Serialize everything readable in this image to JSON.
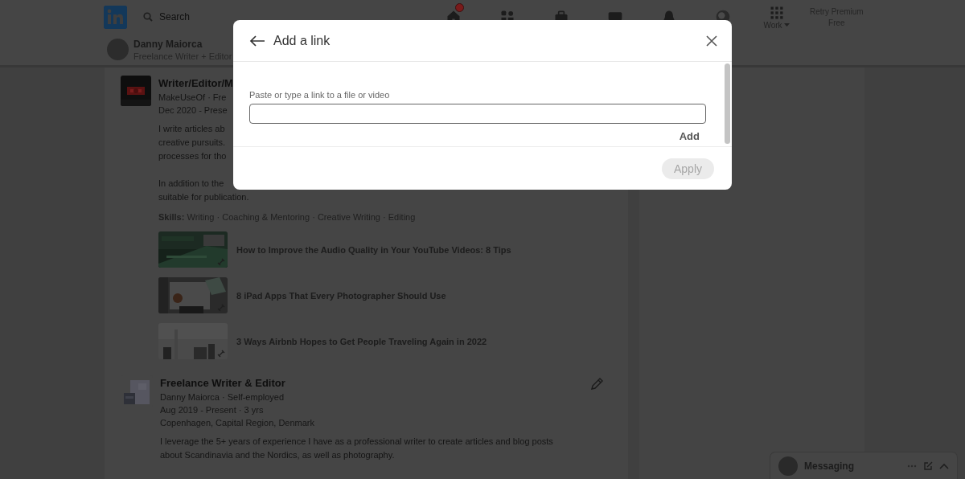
{
  "nav": {
    "search": {
      "placeholder": "Search"
    },
    "items": [
      {
        "kind": "home",
        "badge": true
      },
      {
        "kind": "network",
        "badge": false
      },
      {
        "kind": "jobs",
        "badge": false
      },
      {
        "kind": "messages",
        "badge": false
      },
      {
        "kind": "notifications",
        "badge": false
      },
      {
        "kind": "me",
        "badge": false
      },
      {
        "kind": "apps",
        "label": "Work",
        "badge": false,
        "dropdown": true
      }
    ],
    "premium": [
      "Retry Premium",
      "Free"
    ]
  },
  "profile_bar": {
    "name": "Danny Maiorca",
    "headline": "Freelance Writer + Editor"
  },
  "experience": [
    {
      "title": "Writer/Editor/M",
      "company": "MakeUseOf · Fre",
      "dates": "Dec 2020 - Prese",
      "description": [
        [
          "I write articles ab",
          "creative pursuits.",
          "processes for tho"
        ],
        [
          "In addition to the",
          "suitable for publication."
        ]
      ],
      "skills": "**Skills:** Writing · Coaching & Mentoring · Creative Writing · Editing",
      "media": [
        "How to Improve the Audio Quality in Your YouTube Videos: 8 Tips",
        "8 iPad Apps That Every Photographer Should Use",
        "3 Ways Airbnb Hopes to Get People Traveling Again in 2022"
      ]
    },
    {
      "title": "Freelance Writer & Editor",
      "company": "Danny Maiorca · Self-employed",
      "dates": "Aug 2019 - Present · 3 yrs",
      "location": "Copenhagen, Capital Region, Denmark",
      "description": [
        [
          "I leverage the 5+ years of experience I have as a professional writer to create articles and blog posts",
          "about Scandinavia and the Nordics, as well as photography."
        ]
      ],
      "editable": true
    }
  ],
  "modal": {
    "title": "Add a link",
    "field_label": "Paste or type a link to a file or video",
    "add_button": "Add",
    "apply_button": {
      "label": "Apply",
      "disabled": true
    }
  },
  "messaging": {
    "label": "Messaging"
  }
}
